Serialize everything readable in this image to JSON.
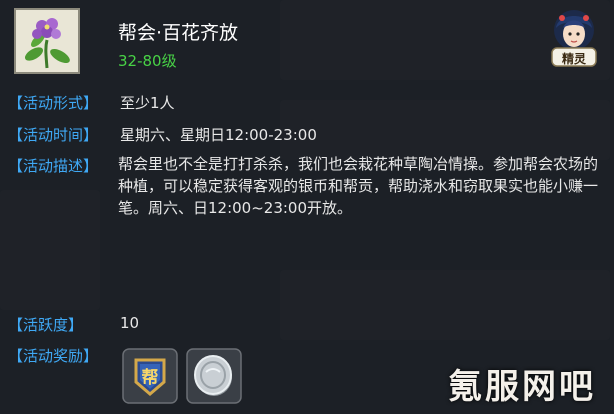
{
  "activity": {
    "title": "帮会·百花齐放",
    "level": "32-80级"
  },
  "badge": {
    "label": "精灵"
  },
  "details": {
    "form": {
      "label": "【活动形式】",
      "value": "至少1人"
    },
    "time": {
      "label": "【活动时间】",
      "value": "星期六、星期日12:00-23:00"
    },
    "desc": {
      "label": "【活动描述】",
      "value": "帮会里也不全是打打杀杀，我们也会栽花种草陶冶情操。参加帮会农场的种植，可以稳定获得客观的银币和帮贡，帮助浇水和窃取果实也能小赚一笔。周六、日12:00~23:00开放。"
    },
    "activity": {
      "label": "【活跃度】",
      "value": "10"
    },
    "reward": {
      "label": "【活动奖励】"
    }
  },
  "rewards": [
    {
      "name": "guild-contribution-icon",
      "glyph": "帮"
    },
    {
      "name": "silver-coin-icon"
    }
  ],
  "watermark": "氪服网吧",
  "colors": {
    "label": "#3fa9f5",
    "level": "#48d246",
    "text": "#e8e8e8",
    "title": "#ffffff"
  }
}
